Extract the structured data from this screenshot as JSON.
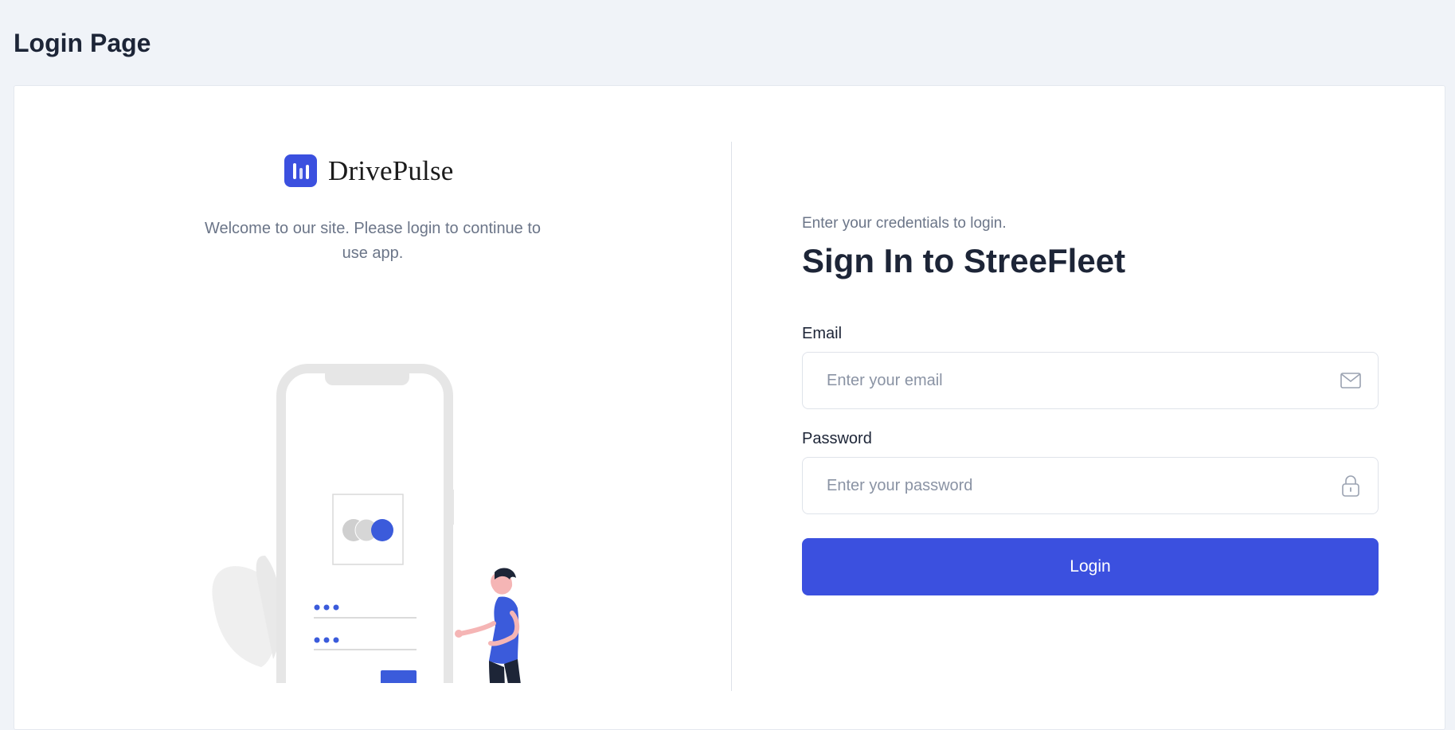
{
  "page": {
    "title": "Login Page"
  },
  "brand": {
    "name": "DrivePulse",
    "logo_icon": "bar-chart-logo-icon",
    "color": "#3b50df"
  },
  "welcome_text": "Welcome to our site. Please login to continue to use app.",
  "form": {
    "subtitle": "Enter your credentials to login.",
    "title": "Sign In to StreeFleet",
    "email": {
      "label": "Email",
      "placeholder": "Enter your email",
      "value": "",
      "icon": "mail-icon"
    },
    "password": {
      "label": "Password",
      "placeholder": "Enter your password",
      "value": "",
      "icon": "lock-icon"
    },
    "submit_label": "Login"
  },
  "colors": {
    "accent": "#3b50df",
    "background": "#f0f3f8",
    "heading": "#1d2537",
    "muted": "#6b7588"
  }
}
